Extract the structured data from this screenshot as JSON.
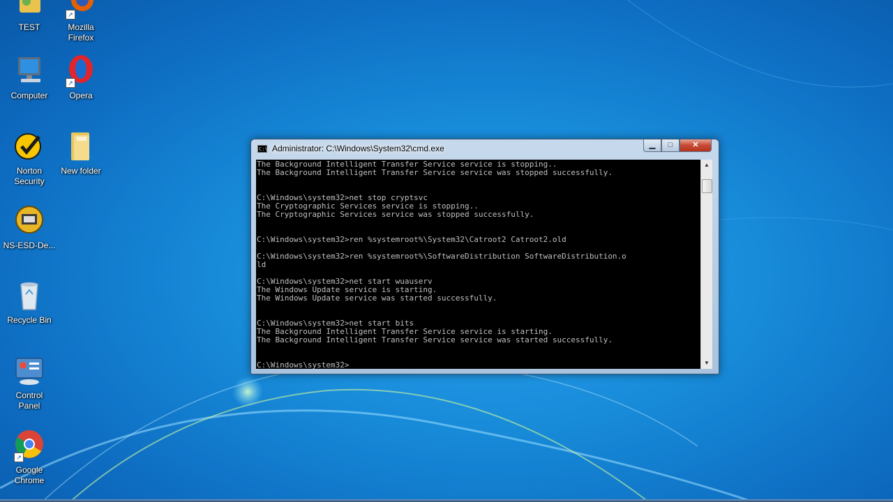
{
  "desktop": {
    "icons": [
      {
        "label": "TEST",
        "icon": "user-folder-icon"
      },
      {
        "label": "Mozilla\nFirefox",
        "icon": "firefox-icon"
      },
      {
        "label": "Computer",
        "icon": "computer-icon"
      },
      {
        "label": "Opera",
        "icon": "opera-icon"
      },
      {
        "label": "Norton\nSecurity",
        "icon": "norton-icon"
      },
      {
        "label": "New folder",
        "icon": "folder-icon"
      },
      {
        "label": "NS-ESD-De...",
        "icon": "installer-icon"
      },
      {
        "label": "Recycle Bin",
        "icon": "recycle-bin-icon"
      },
      {
        "label": "Control\nPanel",
        "icon": "control-panel-icon"
      },
      {
        "label": "Google\nChrome",
        "icon": "chrome-icon"
      }
    ]
  },
  "cmd": {
    "title": "Administrator: C:\\Windows\\System32\\cmd.exe",
    "icon": "cmd-icon",
    "buttons": {
      "minimize": "minimize-icon",
      "maximize": "maximize-icon",
      "close": "close-icon"
    },
    "lines": [
      "The Background Intelligent Transfer Service service is stopping..",
      "The Background Intelligent Transfer Service service was stopped successfully.",
      "",
      "",
      "C:\\Windows\\system32>net stop cryptsvc",
      "The Cryptographic Services service is stopping..",
      "The Cryptographic Services service was stopped successfully.",
      "",
      "",
      "C:\\Windows\\system32>ren %systemroot%\\System32\\Catroot2 Catroot2.old",
      "",
      "C:\\Windows\\system32>ren %systemroot%\\SoftwareDistribution SoftwareDistribution.o",
      "ld",
      "",
      "C:\\Windows\\system32>net start wuauserv",
      "The Windows Update service is starting.",
      "The Windows Update service was started successfully.",
      "",
      "",
      "C:\\Windows\\system32>net start bits",
      "The Background Intelligent Transfer Service service is starting.",
      "The Background Intelligent Transfer Service service was started successfully.",
      "",
      "",
      "C:\\Windows\\system32>_"
    ]
  },
  "colors": {
    "desktop": "#178ad8",
    "console_bg": "#000000",
    "console_fg": "#c0c0c0",
    "close_button": "#c74a33"
  }
}
